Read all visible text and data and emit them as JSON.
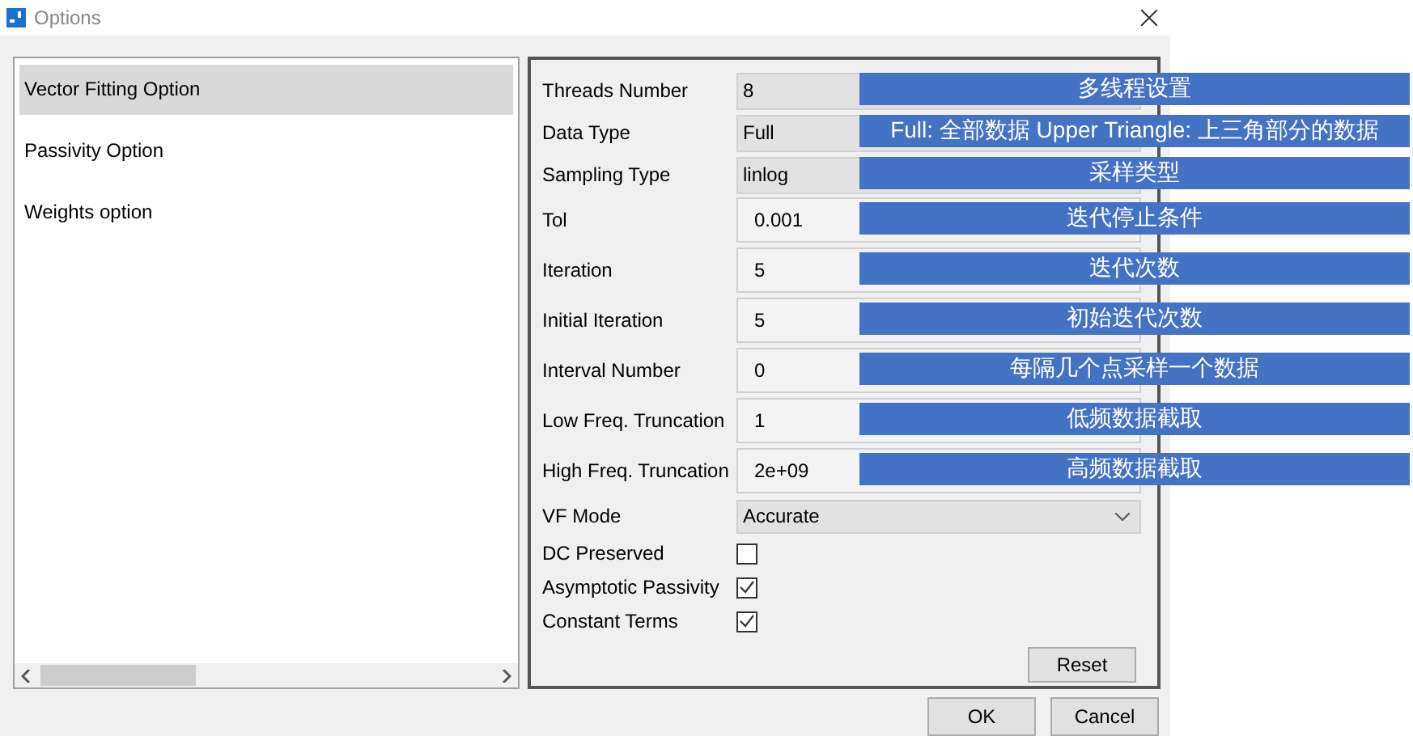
{
  "window": {
    "title": "Options"
  },
  "sidebar": {
    "items": [
      {
        "label": "Vector Fitting Option",
        "selected": true
      },
      {
        "label": "Passivity Option",
        "selected": false
      },
      {
        "label": "Weights option",
        "selected": false
      }
    ]
  },
  "settings": [
    {
      "kind": "readonly",
      "label": "Threads Number",
      "value": "8",
      "annotation": "多线程设置"
    },
    {
      "kind": "readonly",
      "label": "Data Type",
      "value": "Full",
      "annotation": "Full: 全部数据 Upper Triangle: 上三角部分的数据"
    },
    {
      "kind": "readonly",
      "label": "Sampling Type",
      "value": "linlog",
      "annotation": "采样类型"
    },
    {
      "kind": "input",
      "label": "Tol",
      "value": "0.001",
      "annotation": "迭代停止条件"
    },
    {
      "kind": "input",
      "label": "Iteration",
      "value": "5",
      "annotation": "迭代次数"
    },
    {
      "kind": "input",
      "label": "Initial Iteration",
      "value": "5",
      "annotation": "初始迭代次数"
    },
    {
      "kind": "input",
      "label": "Interval Number",
      "value": "0",
      "annotation": "每隔几个点采样一个数据"
    },
    {
      "kind": "input",
      "label": "Low Freq. Truncation",
      "value": "1",
      "annotation": "低频数据截取"
    },
    {
      "kind": "input",
      "label": "High Freq. Truncation",
      "value": "2e+09",
      "annotation": "高频数据截取"
    },
    {
      "kind": "select",
      "label": "VF Mode",
      "value": "Accurate"
    },
    {
      "kind": "checkbox",
      "label": "DC Preserved",
      "checked": false
    },
    {
      "kind": "checkbox",
      "label": "Asymptotic Passivity",
      "checked": true
    },
    {
      "kind": "checkbox",
      "label": "Constant Terms",
      "checked": true
    }
  ],
  "buttons": {
    "reset": "Reset",
    "ok": "OK",
    "cancel": "Cancel"
  }
}
